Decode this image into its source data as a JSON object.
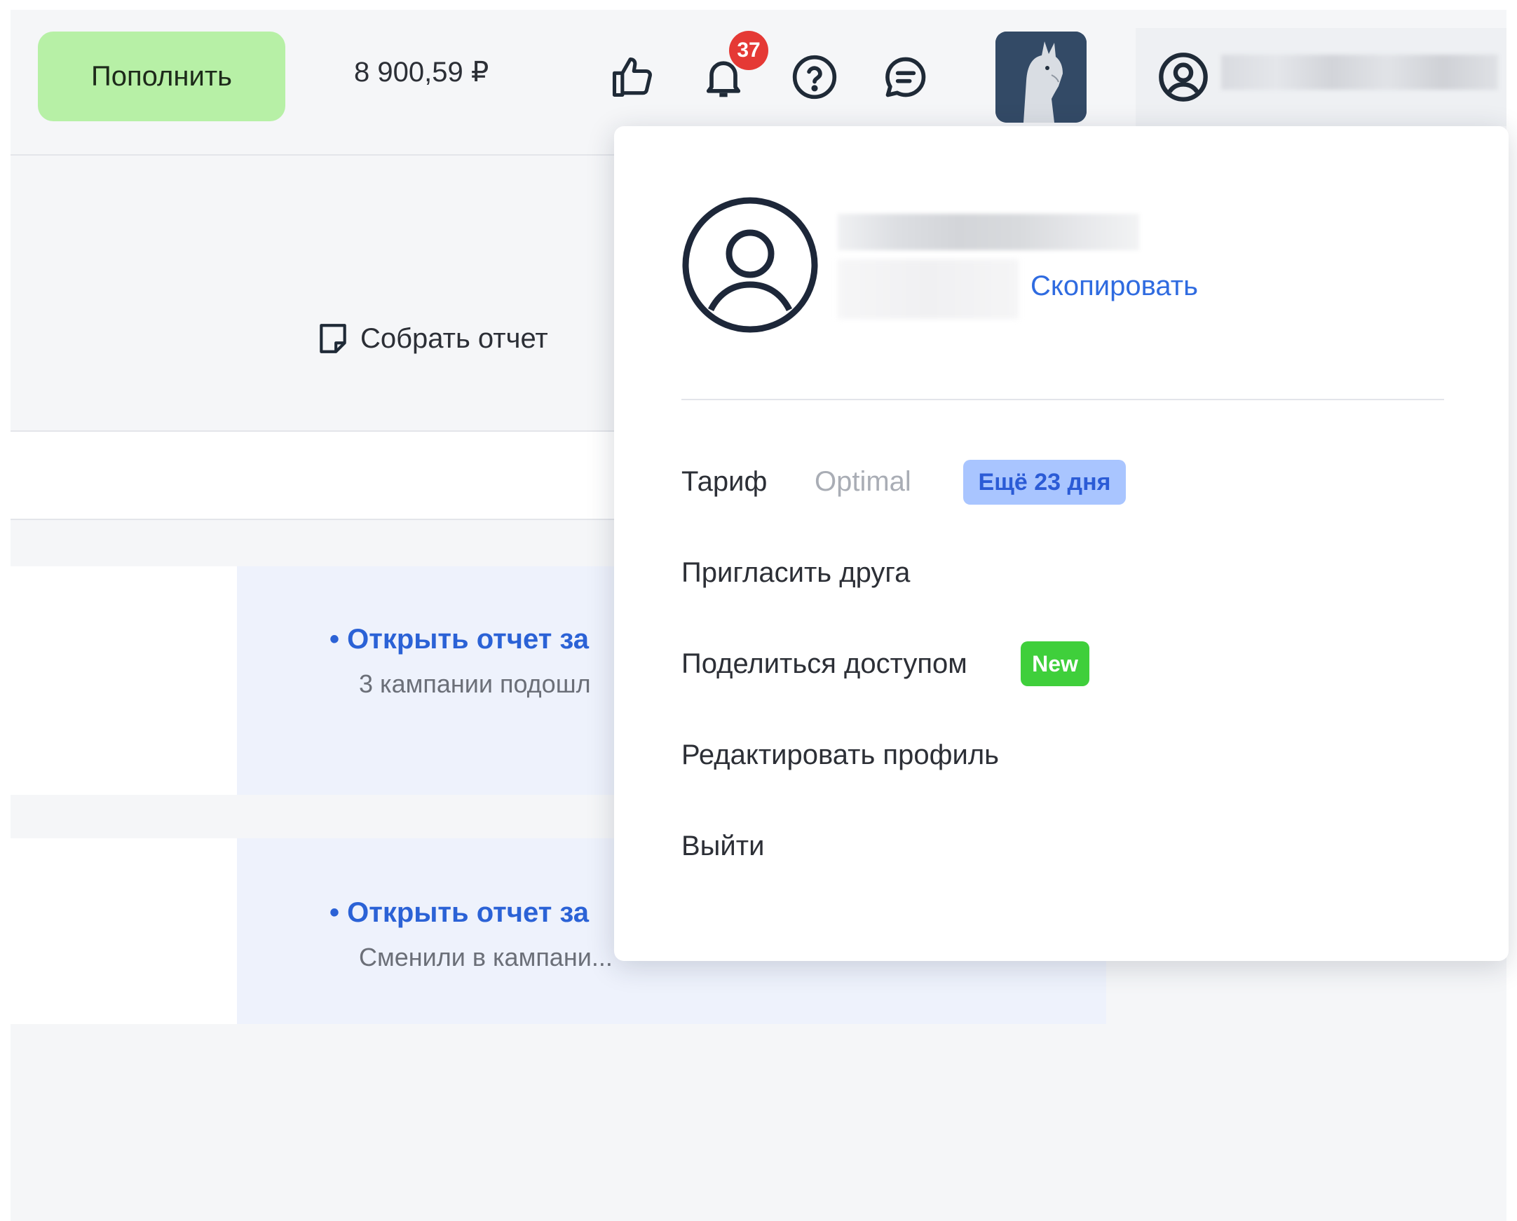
{
  "header": {
    "topup_label": "Пополнить",
    "balance": "8 900,59 ₽",
    "notifications_count": "37",
    "icons": [
      "thumbs-up-icon",
      "bell-icon",
      "help-circle-icon",
      "chat-icon",
      "user-circle-icon"
    ]
  },
  "page": {
    "build_report_label": "Собрать отчет",
    "cards": [
      {
        "link": "• Открыть отчет за",
        "subtitle": "3 кампании подошл"
      },
      {
        "link": "• Открыть отчет за",
        "subtitle": "Сменили в кампани..."
      }
    ]
  },
  "dropdown": {
    "copy_label": "Скопировать",
    "tariff": {
      "label": "Тариф",
      "value": "Optimal",
      "badge": "Ещё 23 дня"
    },
    "menu": {
      "invite": "Пригласить друга",
      "share": "Поделиться доступом",
      "share_badge": "New",
      "edit_profile": "Редактировать профиль",
      "logout": "Выйти"
    }
  },
  "colors": {
    "topup_bg": "#b7f0a6",
    "badge_red": "#e53935",
    "link_blue": "#2b62d6",
    "days_badge_bg": "#a9c5ff",
    "new_badge_bg": "#3fcf3b"
  }
}
